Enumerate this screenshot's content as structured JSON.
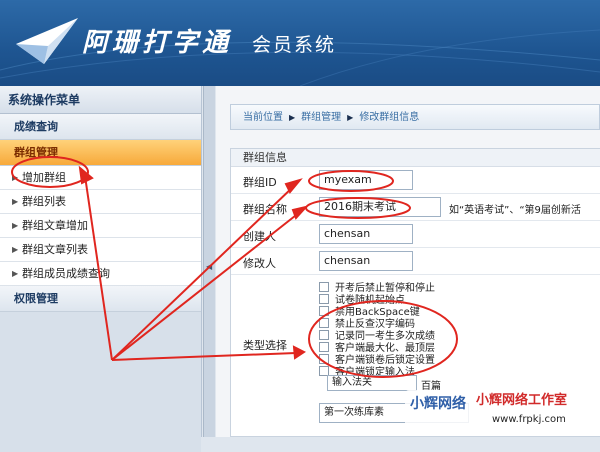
{
  "header": {
    "logo_text": "阿珊打字通",
    "subtitle": "会员系统"
  },
  "sidebar": {
    "title": "系统操作菜单",
    "groups": [
      {
        "label": "成绩查询",
        "active": false
      },
      {
        "label": "群组管理",
        "active": true
      },
      {
        "label": "权限管理",
        "active": false
      }
    ],
    "items": [
      {
        "label": "增加群组"
      },
      {
        "label": "群组列表"
      },
      {
        "label": "群组文章增加"
      },
      {
        "label": "群组文章列表"
      },
      {
        "label": "群组成员成绩查询"
      }
    ]
  },
  "breadcrumb": {
    "items": [
      "当前位置",
      "群组管理",
      "修改群组信息"
    ]
  },
  "form": {
    "section_title": "群组信息",
    "fields": {
      "group_id": {
        "label": "群组ID",
        "value": "myexam"
      },
      "group_name": {
        "label": "群组名称",
        "value": "2016期末考试",
        "hint": "如“英语考试”、“第9届创新活"
      },
      "creator": {
        "label": "创建人",
        "value": "chensan"
      },
      "modifier": {
        "label": "修改人",
        "value": "chensan"
      }
    },
    "type_label": "类型选择",
    "options": [
      "开考后禁止暂停和停止",
      "试卷随机起始点",
      "禁用BackSpace键",
      "禁止反查汉字编码",
      "记录同一考生多次成绩",
      "客户端最大化、最顶层",
      "客户端锁卷后锁定设置",
      "客户端锁定输入法"
    ],
    "partial_text_1": "输入法关",
    "partial_text_2": "百篇",
    "partial_text_3": "第一次练库素"
  },
  "watermark": {
    "brand": "小辉网络",
    "name": "小辉网络工作室",
    "url": "www.frpkj.com"
  },
  "colors": {
    "header_bg": "#1e5591",
    "active_group": "#f7a93a",
    "annotation_red": "#e0261f"
  }
}
